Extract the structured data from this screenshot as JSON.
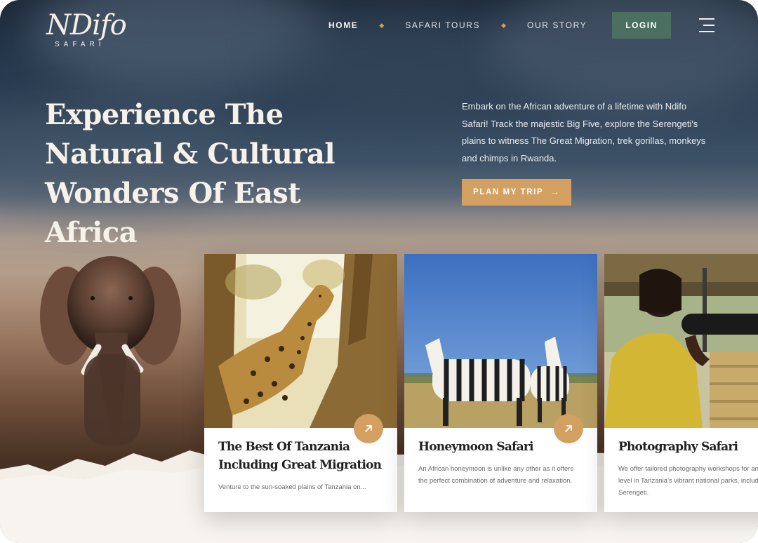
{
  "brand": {
    "logo_word": "NDifo",
    "logo_sub": "SAFARI"
  },
  "nav": {
    "items": [
      {
        "label": "HOME"
      },
      {
        "label": "SAFARI TOURS"
      },
      {
        "label": "OUR STORY"
      }
    ],
    "login_label": "LOGIN",
    "menu_icon": "hamburger-menu-icon"
  },
  "hero": {
    "title": "Experience The Natural & Cultural Wonders Of East Africa",
    "description": "Embark on the African adventure of a lifetime with Ndifo Safari! Track the majestic Big Five, explore the Serengeti's plains to witness The Great Migration, trek gorillas, monkeys and chimps in Rwanda.",
    "cta_label": "PLAN MY TRIP",
    "cta_arrow": "→"
  },
  "cards": [
    {
      "title": "The Best Of Tanzania Including Great Migration",
      "text": "Venture to the sun-soaked plains of Tanzania on...",
      "image": "leopard-in-tree-photo",
      "icon": "arrow-up-right-icon"
    },
    {
      "title": "Honeymoon Safari",
      "text": "An African honeymoon is unlike any other as it offers the perfect combination of adventure and relaxation.",
      "image": "zebras-photo",
      "icon": "arrow-up-right-icon"
    },
    {
      "title": "Photography Safari",
      "text": "We offer tailored photography workshops for any skill level in Tanzania's vibrant national parks, including the Serengeti.",
      "image": "photographer-with-camera-photo",
      "icon": "arrow-up-right-icon"
    }
  ],
  "colors": {
    "accent": "#d4a062",
    "login_bg": "#4b7061",
    "sky": "#24364a"
  }
}
